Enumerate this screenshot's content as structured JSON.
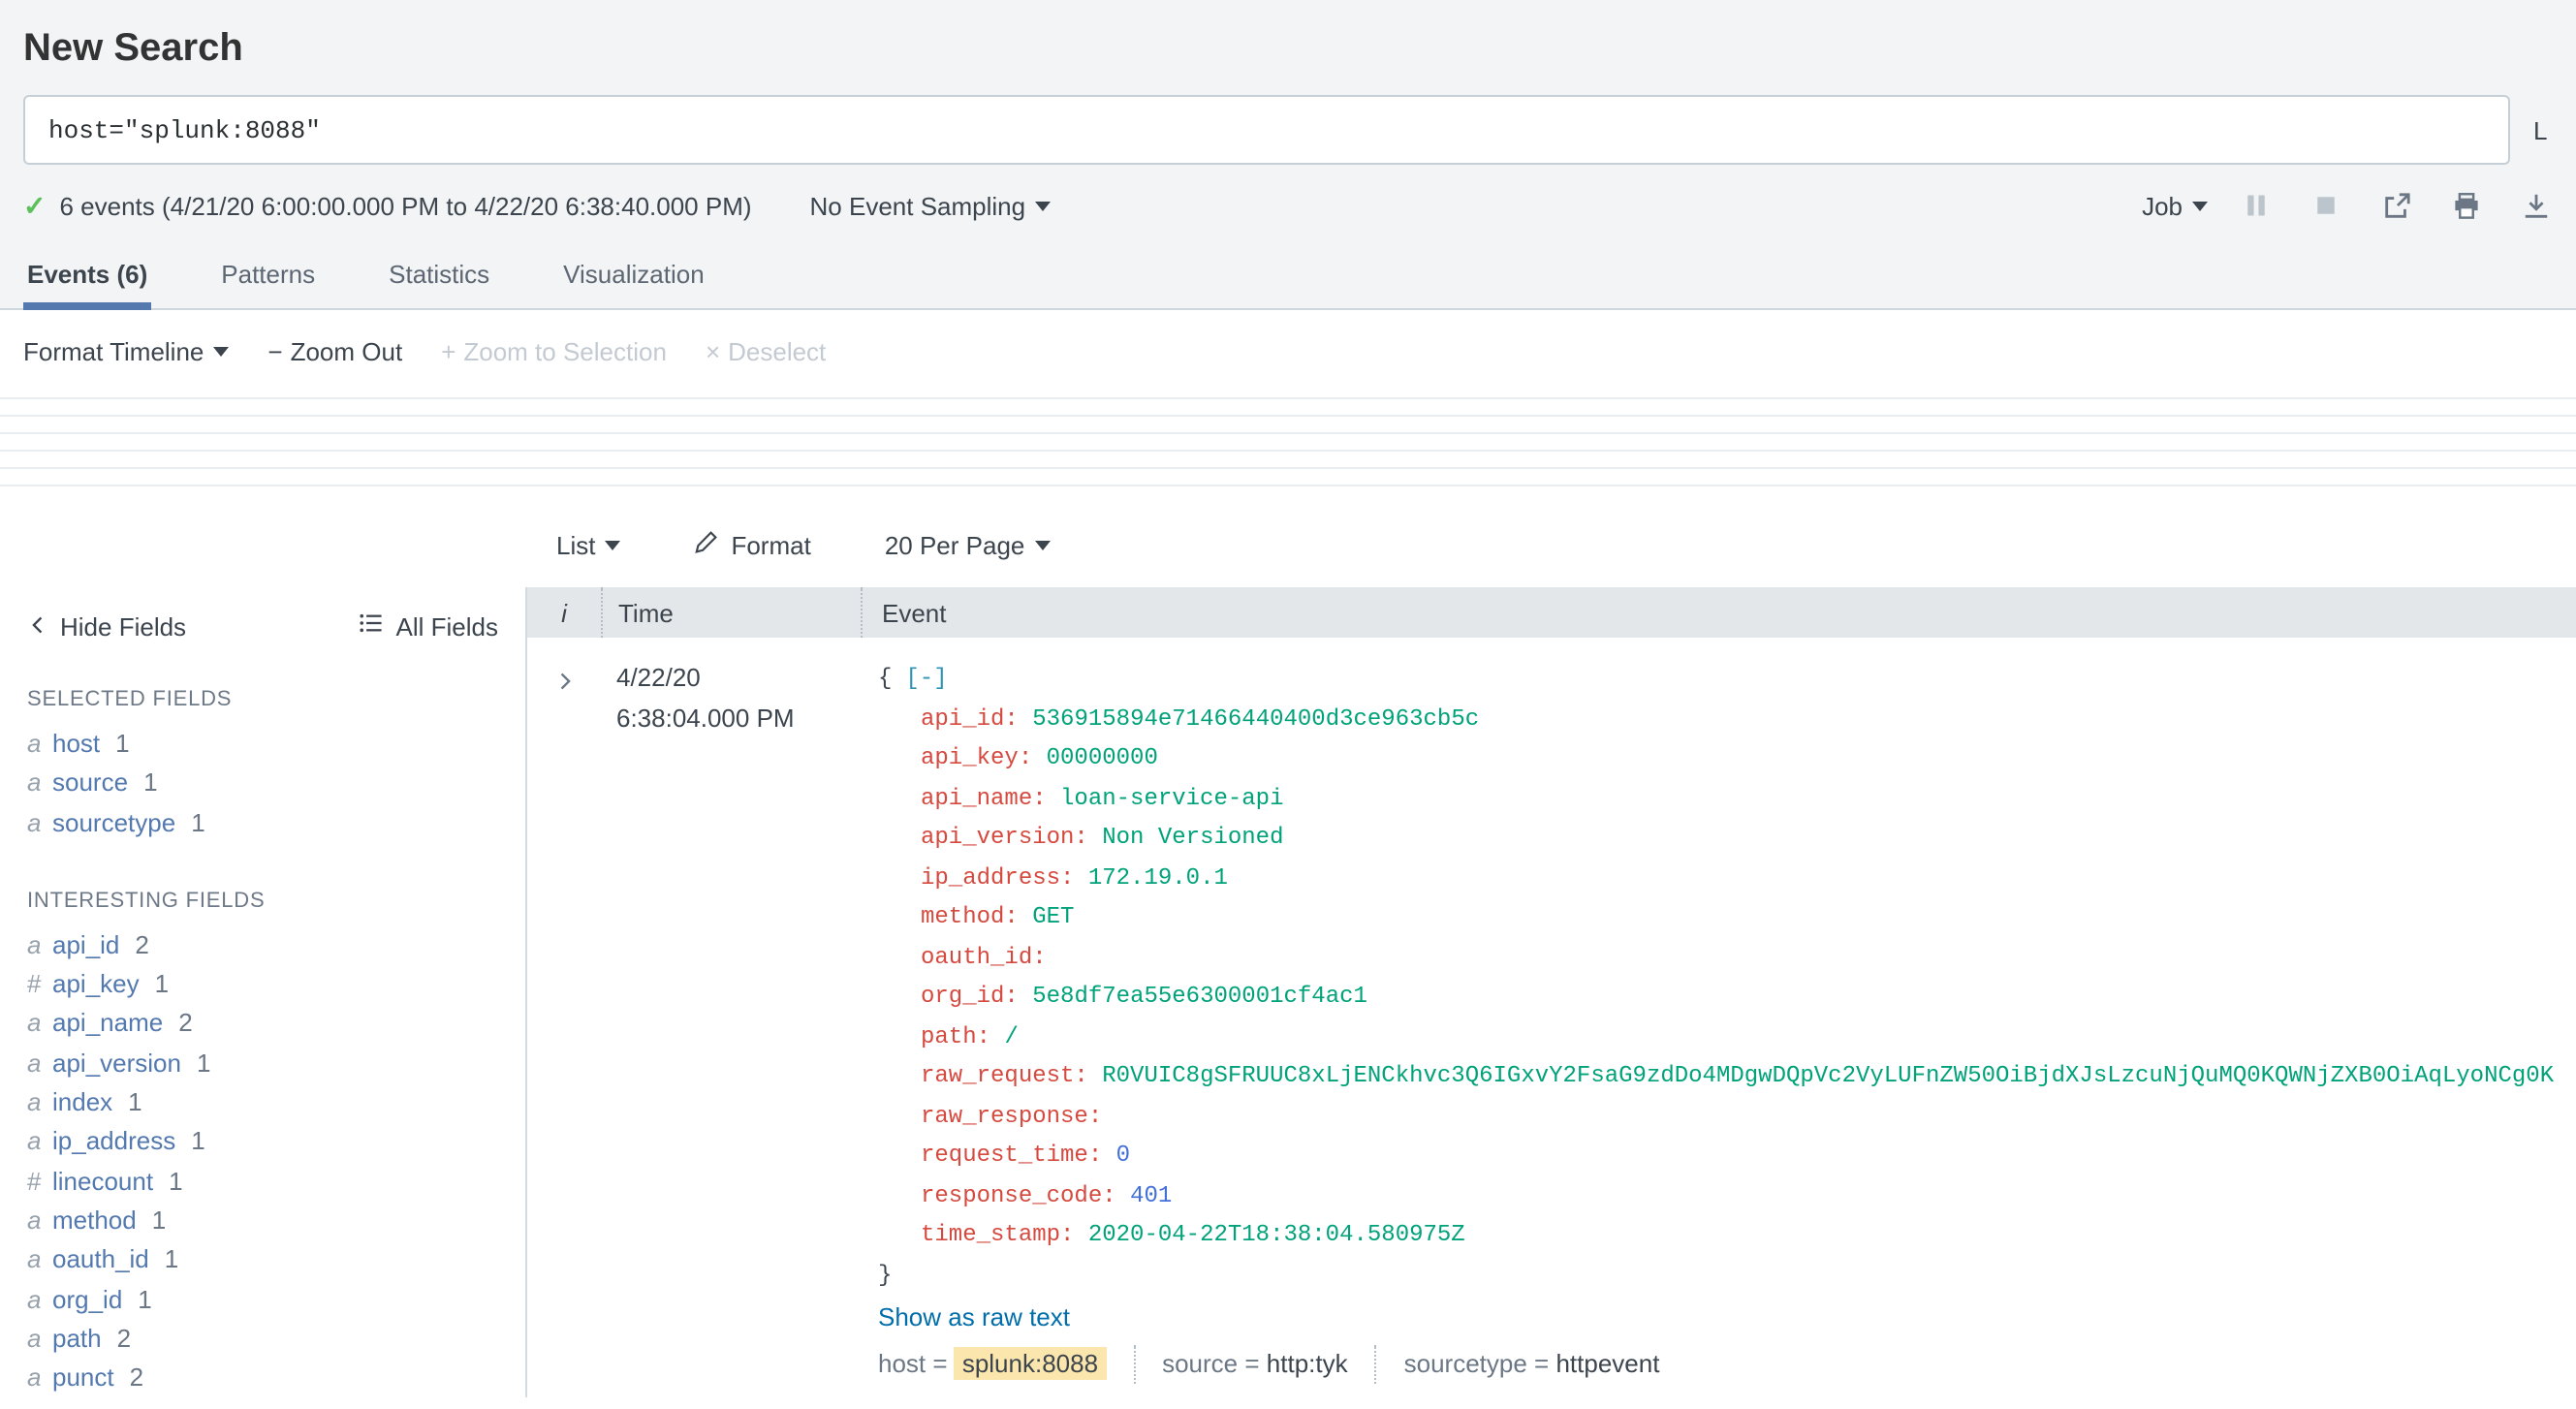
{
  "page": {
    "title": "New Search"
  },
  "search_bar": {
    "query": "host=\"splunk:8088\"",
    "time_picker_visible_text": "L"
  },
  "status": {
    "result_text": "6 events (4/21/20 6:00:00.000 PM to 4/22/20 6:38:40.000 PM)",
    "sampling_label": "No Event Sampling",
    "job_label": "Job",
    "job_icons": [
      "pause",
      "stop",
      "share",
      "print",
      "download"
    ]
  },
  "tabs": [
    {
      "label": "Events (6)",
      "active": true
    },
    {
      "label": "Patterns",
      "active": false
    },
    {
      "label": "Statistics",
      "active": false
    },
    {
      "label": "Visualization",
      "active": false
    }
  ],
  "timeline_bar": {
    "format_label": "Format Timeline",
    "zoom_out_prefix": "−",
    "zoom_out_label": "Zoom Out",
    "zoom_selection_prefix": "+",
    "zoom_selection_label": "Zoom to Selection",
    "deselect_prefix": "×",
    "deselect_label": "Deselect"
  },
  "results_toolbar": {
    "list_label": "List",
    "format_label": "Format",
    "per_page_label": "20 Per Page"
  },
  "fields_panel": {
    "hide_label": "Hide Fields",
    "all_label": "All Fields",
    "selected_header": "SELECTED FIELDS",
    "selected_fields": [
      {
        "type": "a",
        "name": "host",
        "count": "1"
      },
      {
        "type": "a",
        "name": "source",
        "count": "1"
      },
      {
        "type": "a",
        "name": "sourcetype",
        "count": "1"
      }
    ],
    "interesting_header": "INTERESTING FIELDS",
    "interesting_fields": [
      {
        "type": "a",
        "name": "api_id",
        "count": "2"
      },
      {
        "type": "#",
        "name": "api_key",
        "count": "1"
      },
      {
        "type": "a",
        "name": "api_name",
        "count": "2"
      },
      {
        "type": "a",
        "name": "api_version",
        "count": "1"
      },
      {
        "type": "a",
        "name": "index",
        "count": "1"
      },
      {
        "type": "a",
        "name": "ip_address",
        "count": "1"
      },
      {
        "type": "#",
        "name": "linecount",
        "count": "1"
      },
      {
        "type": "a",
        "name": "method",
        "count": "1"
      },
      {
        "type": "a",
        "name": "oauth_id",
        "count": "1"
      },
      {
        "type": "a",
        "name": "org_id",
        "count": "1"
      },
      {
        "type": "a",
        "name": "path",
        "count": "2"
      },
      {
        "type": "a",
        "name": "punct",
        "count": "2"
      }
    ]
  },
  "events_table": {
    "headers": {
      "info": "i",
      "time": "Time",
      "event": "Event"
    },
    "row": {
      "date": "4/22/20",
      "time": "6:38:04.000 PM",
      "json_open": "{",
      "collapse_toggle": "[-]",
      "json_close": "}",
      "fields": [
        {
          "key": "api_id",
          "value": "536915894e71466440400d3ce963cb5c",
          "type": "string"
        },
        {
          "key": "api_key",
          "value": "00000000",
          "type": "string"
        },
        {
          "key": "api_name",
          "value": "loan-service-api",
          "type": "string"
        },
        {
          "key": "api_version",
          "value": "Non Versioned",
          "type": "string"
        },
        {
          "key": "ip_address",
          "value": "172.19.0.1",
          "type": "string"
        },
        {
          "key": "method",
          "value": "GET",
          "type": "string"
        },
        {
          "key": "oauth_id",
          "value": "",
          "type": "string"
        },
        {
          "key": "org_id",
          "value": "5e8df7ea55e6300001cf4ac1",
          "type": "string"
        },
        {
          "key": "path",
          "value": "/",
          "type": "string"
        },
        {
          "key": "raw_request",
          "value": "R0VUIC8gSFRUUC8xLjENCkhvc3Q6IGxvY2FsaG9zdDo4MDgwDQpVc2VyLUFnZW50OiBjdXJsLzcuNjQuMQ0KQWNjZXB0OiAqLyoNCg0K",
          "type": "string"
        },
        {
          "key": "raw_response",
          "value": "",
          "type": "string"
        },
        {
          "key": "request_time",
          "value": "0",
          "type": "number"
        },
        {
          "key": "response_code",
          "value": "401",
          "type": "number"
        },
        {
          "key": "time_stamp",
          "value": "2020-04-22T18:38:04.580975Z",
          "type": "string"
        }
      ],
      "raw_link": "Show as raw text",
      "meta": [
        {
          "key": "host",
          "value": "splunk:8088",
          "highlight": true
        },
        {
          "key": "source",
          "value": "http:tyk",
          "highlight": false
        },
        {
          "key": "sourcetype",
          "value": "httpevent",
          "highlight": false
        }
      ]
    }
  },
  "colors": {
    "header_bg": "#f2f4f5",
    "table_header_bg": "#e3e7ea",
    "accent_green": "#5cc05c",
    "tab_underline": "#5379af",
    "field_link": "#5379af",
    "link_blue": "#006eaa",
    "json_key": "#d6493f",
    "json_string": "#00a27a",
    "json_number": "#426fd9",
    "collapse_toggle": "#2f94b4",
    "highlight_bg": "#fbe7ad"
  }
}
